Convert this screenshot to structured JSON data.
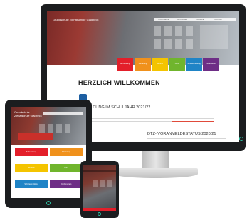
{
  "school_name": "Grundschule Zienatschule Gladbeck",
  "monitor": {
    "nav_items": [
      "STARTSEITE",
      "AKTUELLES",
      "SCHULE",
      "KONTAKT"
    ],
    "tiles": [
      {
        "label": "Schulleitung",
        "color": "#e31f2a"
      },
      {
        "label": "Förderung",
        "color": "#f0911c"
      },
      {
        "label": "Termine",
        "color": "#f4c400"
      },
      {
        "label": "OGS",
        "color": "#70b52d"
      },
      {
        "label": "Schulanmeldung",
        "color": "#1f84c6"
      },
      {
        "label": "Förderverein",
        "color": "#6e2e86"
      }
    ],
    "heading": "HERZLICH WILLKOMMEN",
    "section1": "ANMELDUNG IM SCHULJAHR 2021/22",
    "section2": "DTZ- VORANMELDESTATUS 2020/21"
  },
  "tablet": {
    "blocks": [
      {
        "label": "Schulleitung",
        "color": "#e31f2a"
      },
      {
        "label": "Förderung",
        "color": "#f0911c"
      },
      {
        "label": "Termine",
        "color": "#f4c400"
      },
      {
        "label": "OGS",
        "color": "#70b52d"
      },
      {
        "label": "Schulanmeldung",
        "color": "#1f84c6"
      },
      {
        "label": "Förderverein",
        "color": "#6e2e86"
      }
    ]
  },
  "colors": {
    "bezel": "#1b1d1f",
    "power_led": "#2ec4a6",
    "accent_red": "#e31f2a"
  }
}
